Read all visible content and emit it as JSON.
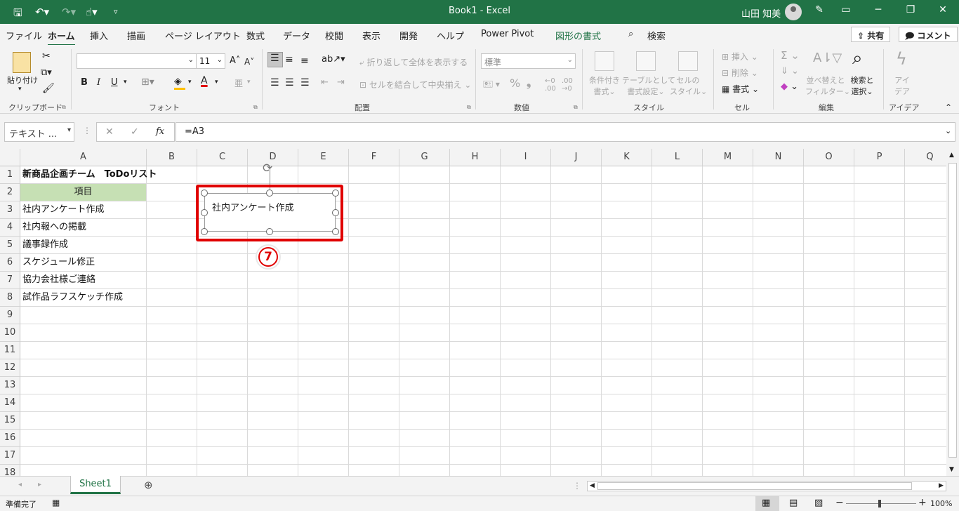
{
  "window": {
    "title": "Book1  -  Excel",
    "user_name": "山田 知美"
  },
  "tabs": [
    {
      "label": "ファイル"
    },
    {
      "label": "ホーム"
    },
    {
      "label": "挿入"
    },
    {
      "label": "描画"
    },
    {
      "label": "ページ レイアウト"
    },
    {
      "label": "数式"
    },
    {
      "label": "データ"
    },
    {
      "label": "校閲"
    },
    {
      "label": "表示"
    },
    {
      "label": "開発"
    },
    {
      "label": "ヘルプ"
    },
    {
      "label": "Power Pivot"
    },
    {
      "label": "図形の書式"
    },
    {
      "label": "検索"
    }
  ],
  "share": {
    "share_label": "共有",
    "comment_label": "コメント"
  },
  "ribbon": {
    "clipboard": {
      "paste_label": "貼り付け",
      "group_label": "クリップボード"
    },
    "font": {
      "font_name": "",
      "font_size": "11",
      "group_label": "フォント",
      "grow": "A",
      "shrink": "A",
      "bold": "B",
      "italic": "I",
      "underline": "U",
      "font_color_glyph": "A",
      "phonetic_glyph": "亜"
    },
    "alignment": {
      "wrap_label": "折り返して全体を表示する",
      "merge_label": "セルを結合して中央揃え",
      "group_label": "配置"
    },
    "number": {
      "format": "標準",
      "group_label": "数値",
      "percent": "%",
      "comma": "❟"
    },
    "styles": {
      "conditional_label": "条件付き",
      "conditional_label2": "書式",
      "table_label": "テーブルとして",
      "table_label2": "書式設定",
      "cellstyle_label": "セルの",
      "cellstyle_label2": "スタイル",
      "group_label": "スタイル"
    },
    "cells": {
      "insert_label": "挿入",
      "delete_label": "削除",
      "format_label": "書式",
      "group_label": "セル"
    },
    "editing": {
      "sort_label": "並べ替えと",
      "sort_label2": "フィルター",
      "find_label": "検索と",
      "find_label2": "選択",
      "group_label": "編集"
    },
    "ideas": {
      "label": "アイ",
      "label2": "デア",
      "group_label": "アイデア"
    }
  },
  "formula_bar": {
    "name_box": "テキスト ...",
    "formula": "=A3",
    "fx": "fx"
  },
  "columns": [
    "A",
    "B",
    "C",
    "D",
    "E",
    "F",
    "G",
    "H",
    "I",
    "J",
    "K",
    "L",
    "M",
    "N",
    "O",
    "P",
    "Q"
  ],
  "rows": [
    "1",
    "2",
    "3",
    "4",
    "5",
    "6",
    "7",
    "8",
    "9",
    "10",
    "11",
    "12",
    "13",
    "14",
    "15",
    "16",
    "17",
    "18"
  ],
  "cells": {
    "a1": "新商品企画チーム　ToDoリスト",
    "a2": "項目",
    "a3": "社内アンケート作成",
    "a4": "社内報への掲載",
    "a5": "議事録作成",
    "a6": "スケジュール修正",
    "a7": "協力会社様ご連絡",
    "a8": "試作品ラフスケッチ作成"
  },
  "textbox": {
    "text": "社内アンケート作成"
  },
  "annotation": {
    "step": "7"
  },
  "colors": {
    "accent": "#217346",
    "header_fill": "#c6e0b4",
    "highlight": "#e00000"
  },
  "sheets": [
    {
      "label": "Sheet1"
    }
  ],
  "status": {
    "ready": "準備完了",
    "zoom": "100%"
  }
}
